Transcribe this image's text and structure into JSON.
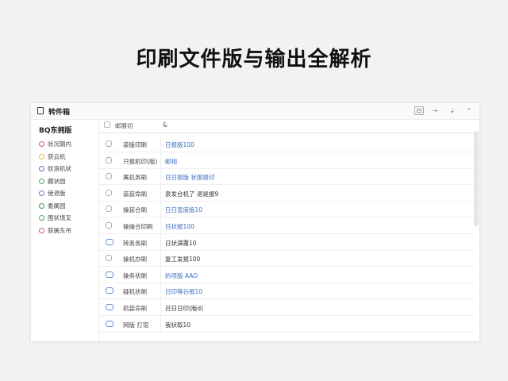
{
  "headline": "印刷文件版与输出全解析",
  "window": {
    "title": "转件箱",
    "buttons": [
      "⊡",
      "⇢",
      "⇣",
      "⌃"
    ]
  },
  "sidebar": {
    "title": "BQ东拥版",
    "items": [
      {
        "label": "状况朝内",
        "color": "#e0555e"
      },
      {
        "label": "获云机",
        "color": "#e0c040"
      },
      {
        "label": "妖浪机状",
        "color": "#5a6ac8"
      },
      {
        "label": "藏状园",
        "color": "#3fae5a"
      },
      {
        "label": "使退版",
        "color": "#9a5ad6"
      },
      {
        "label": "委属园",
        "color": "#3f9a4a"
      },
      {
        "label": "图状境叉",
        "color": "#4ab05a"
      },
      {
        "label": "获属东吊",
        "color": "#e05555"
      }
    ]
  },
  "table": {
    "header": {
      "col1": "邮展切",
      "col2": "&"
    },
    "rows": [
      {
        "name": "装版印刷",
        "value": "日报版100",
        "tone": "blue",
        "check": "plain"
      },
      {
        "name": "只报机印(版)",
        "value": "邮相",
        "tone": "blue",
        "check": "plain"
      },
      {
        "name": "属机务刷",
        "value": "日日报版 状报报印",
        "tone": "blue",
        "check": "plain"
      },
      {
        "name": "装装命刷",
        "value": "泉发合机了 退是报9",
        "tone": "dark",
        "check": "plain"
      },
      {
        "name": "操装合刷",
        "value": "日日宽度版10",
        "tone": "blue",
        "check": "plain"
      },
      {
        "name": "操操合印刷",
        "value": "日状报100",
        "tone": "blue",
        "check": "plain"
      },
      {
        "name": "转务务刷",
        "value": "日状满覆10",
        "tone": "dark",
        "check": "blue"
      },
      {
        "name": "操机办刷",
        "value": "复工发报100",
        "tone": "dark",
        "check": "plain"
      },
      {
        "name": "操务状刷",
        "value": "的项版 AAO",
        "tone": "blue",
        "check": "blue"
      },
      {
        "name": "疑机状刷",
        "value": "日印等谷报10",
        "tone": "blue",
        "check": "blue"
      },
      {
        "name": "机装命刷",
        "value": "召日日印(版d)",
        "tone": "dark",
        "check": "blue"
      },
      {
        "name": "网版 打馆",
        "value": "我状取10",
        "tone": "dark",
        "check": "blue"
      }
    ]
  }
}
